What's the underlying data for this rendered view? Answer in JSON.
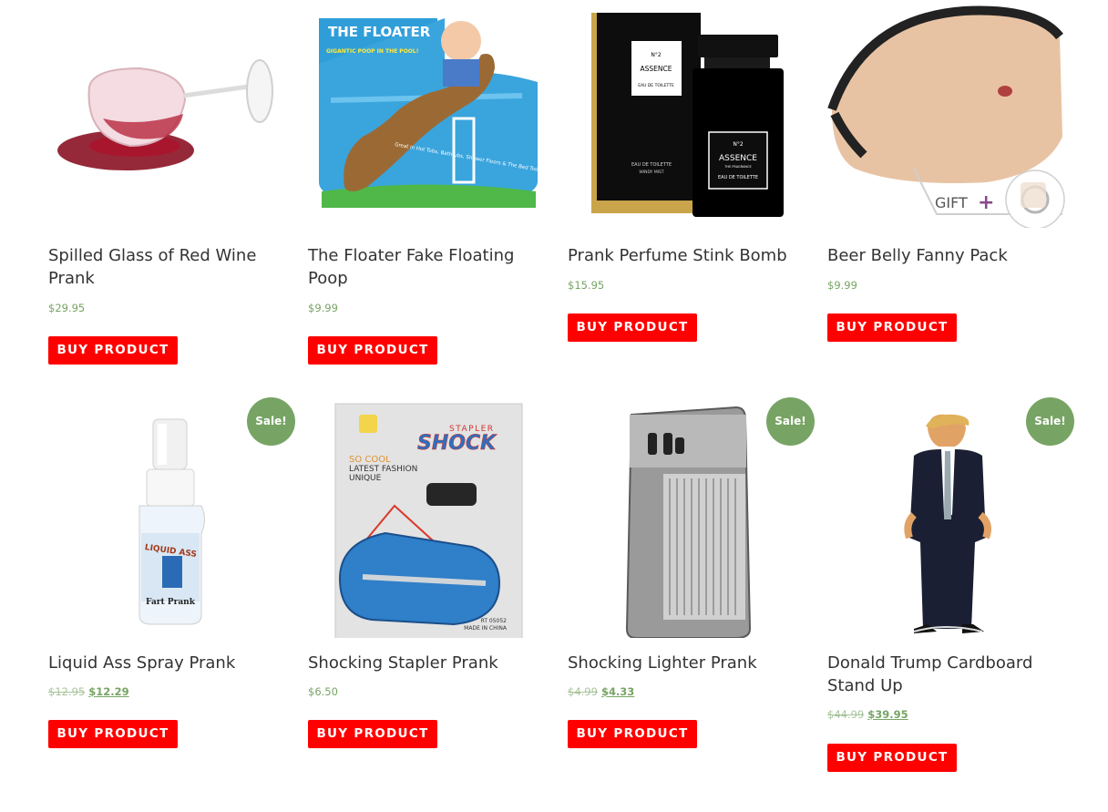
{
  "buy_label": "BUY PRODUCT",
  "sale_label": "Sale!",
  "colors": {
    "button": "#ff0000",
    "sale_badge": "#77a464",
    "price": "#77a464"
  },
  "products": [
    {
      "title": "Spilled Glass of Red Wine Prank",
      "price": "$29.95"
    },
    {
      "title": "The Floater Fake Floating Poop",
      "price": "$9.99",
      "package_text": {
        "brand": "THE FLOATER",
        "tagline": "GIGANTIC POOP IN THE POOL!",
        "features": "Great in Hot Tubs, Bathtubs, Shower Floors & The Bed Too!"
      }
    },
    {
      "title": "Prank Perfume Stink Bomb",
      "price": "$15.95",
      "package_text": {
        "number": "N°2",
        "brand": "ASSENCE",
        "sub": "THE FRAGRANCE",
        "type": "EAU DE TOILETTE",
        "box_type": "EAU DE TOILETTE",
        "box_sub": "WINDY MIST"
      }
    },
    {
      "title": "Beer Belly Fanny Pack",
      "price": "$9.99",
      "gift_label": "GIFT"
    },
    {
      "title": "Liquid Ass Spray Prank",
      "old_price": "$12.95",
      "price": "$12.29",
      "sale": true,
      "package_text": {
        "brand": "LIQUID ASS",
        "label": "Fart Prank"
      }
    },
    {
      "title": "Shocking Stapler Prank",
      "price": "$6.50",
      "package_text": {
        "top": "STAPLER",
        "main": "SHOCK",
        "line1": "SO COOL",
        "line2": "LATEST FASHION",
        "line3": "UNIQUE",
        "code": "RT 05052",
        "origin": "MADE IN CHINA"
      }
    },
    {
      "title": "Shocking Lighter Prank",
      "old_price": "$4.99",
      "price": "$4.33",
      "sale": true
    },
    {
      "title": "Donald Trump Cardboard Stand Up",
      "old_price": "$44.99",
      "price": "$39.95",
      "sale": true
    }
  ]
}
